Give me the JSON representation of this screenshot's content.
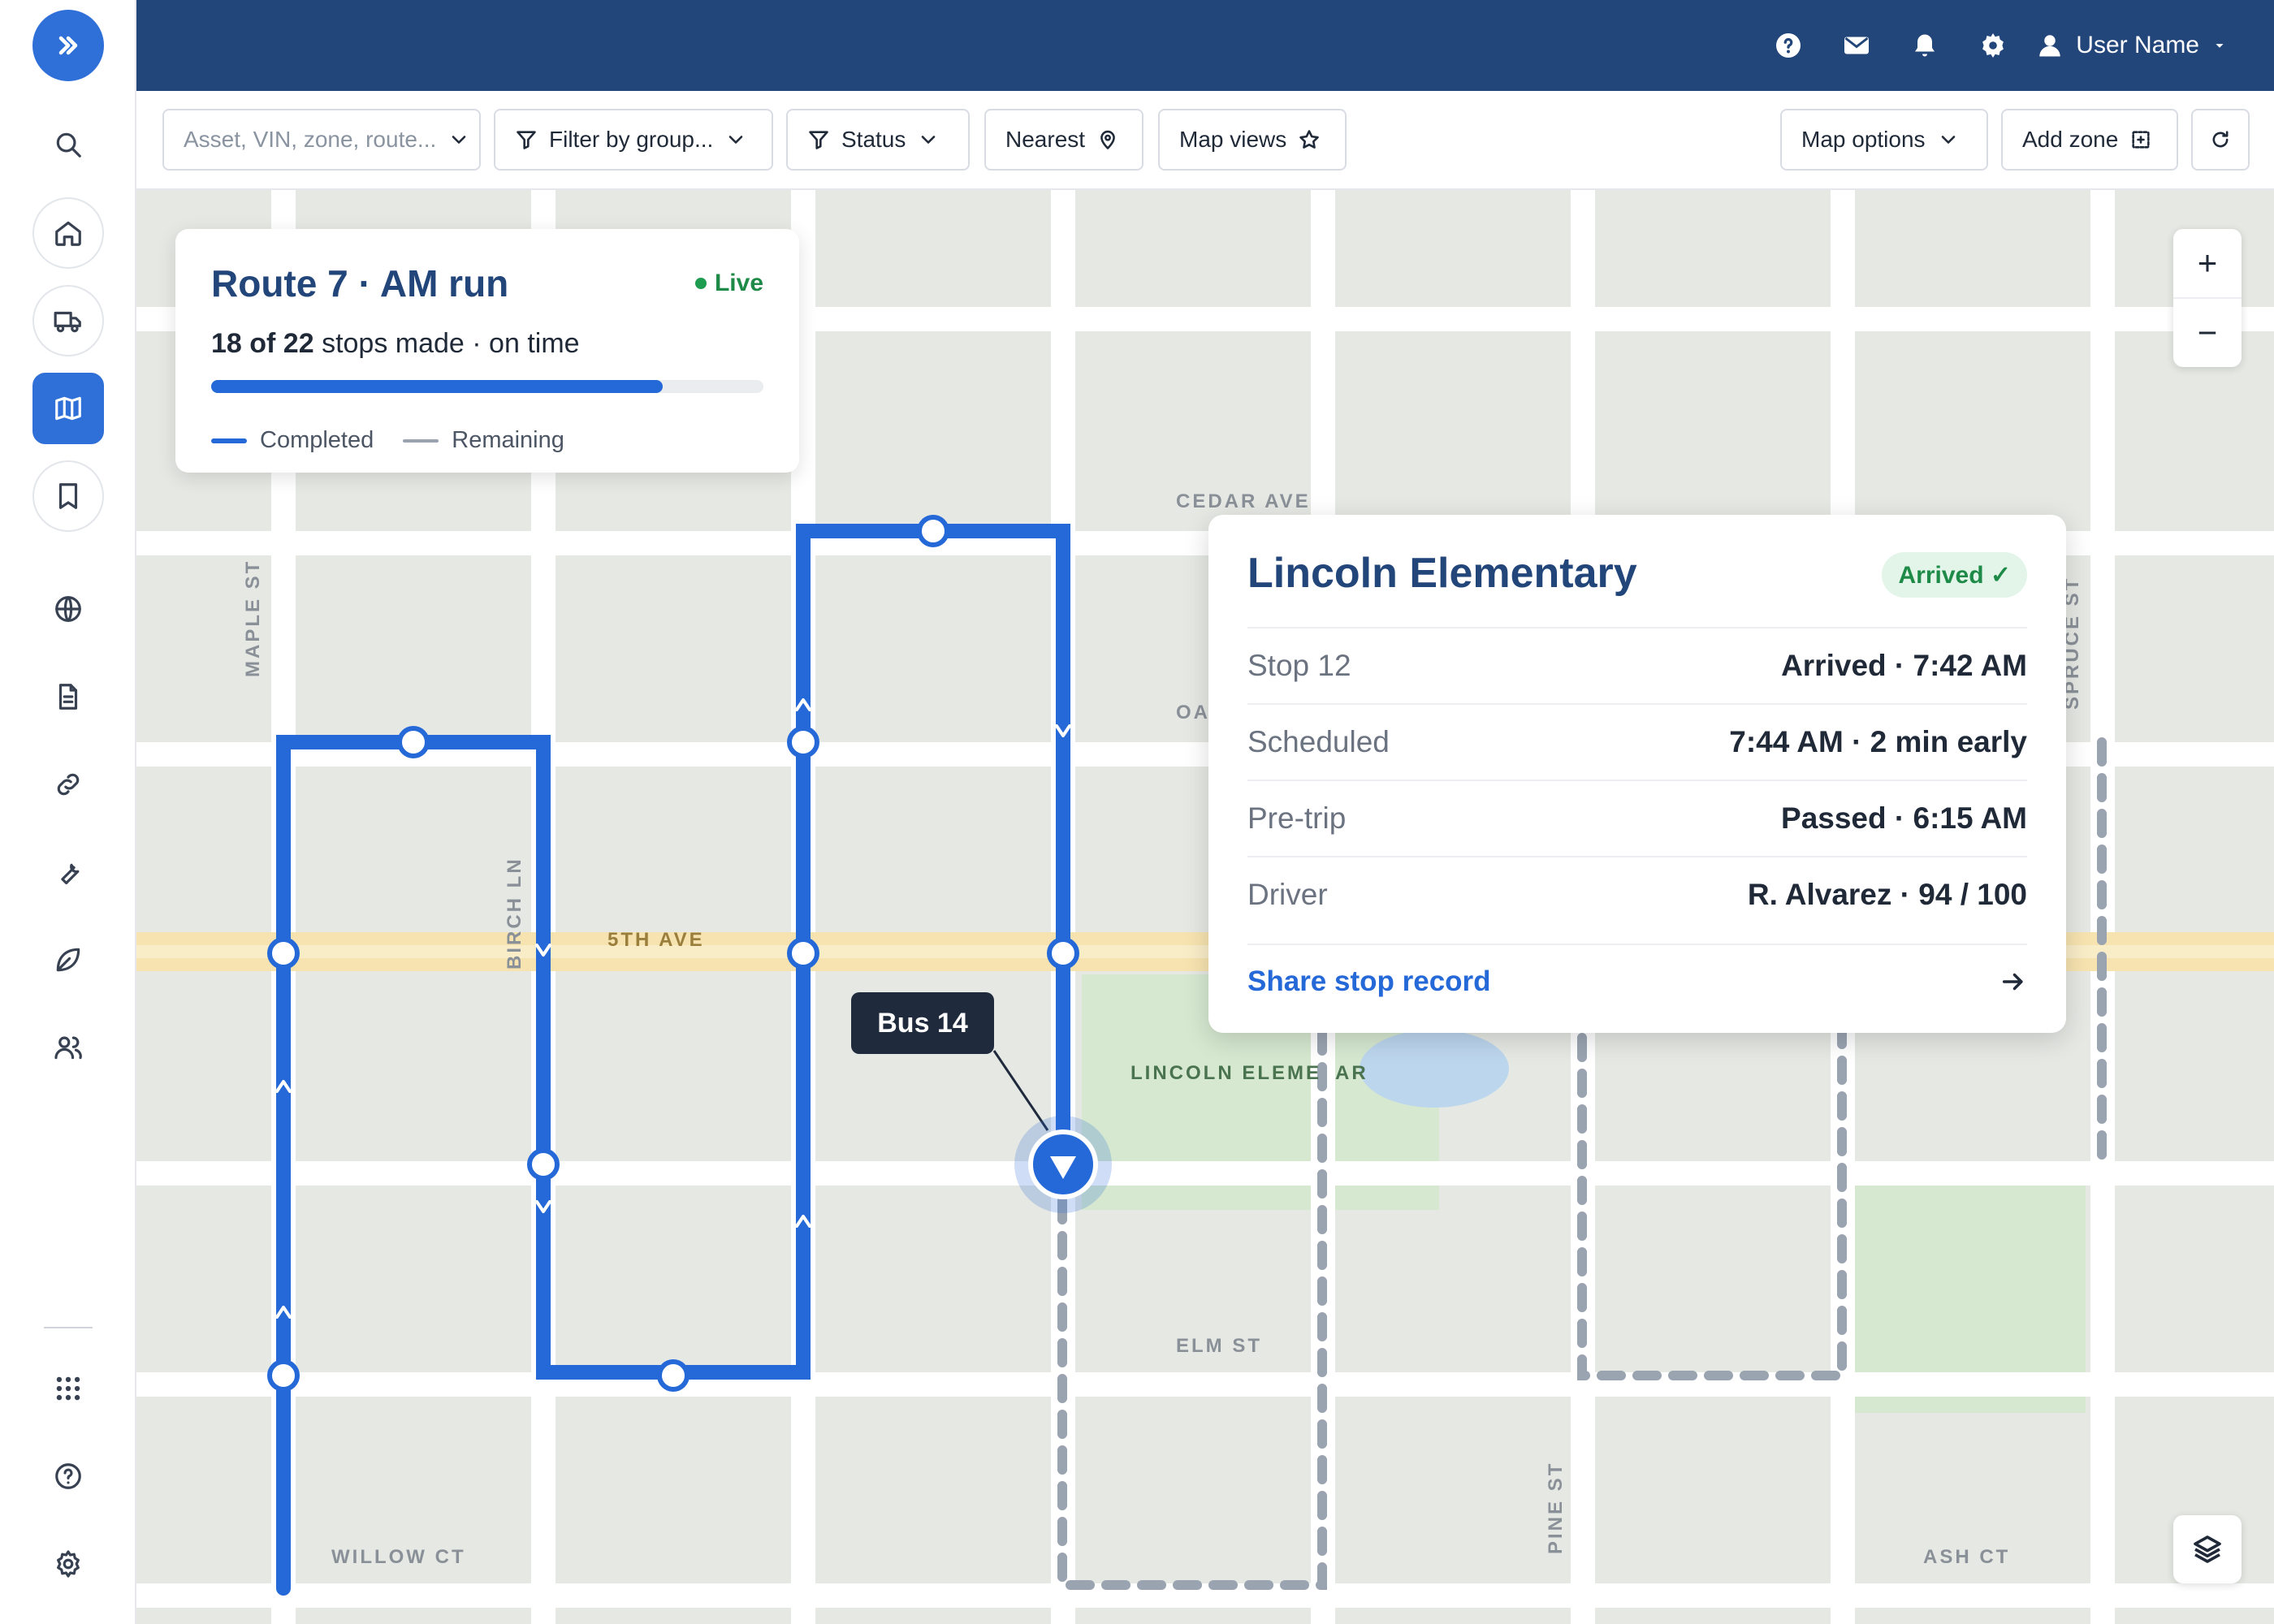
{
  "nav": {
    "icons": [
      "chevrons-right-icon",
      "search-icon",
      "home-icon",
      "truck-icon",
      "map-icon",
      "bookmark-icon",
      "globe-icon",
      "document-icon",
      "link-icon",
      "wrench-icon",
      "leaf-icon",
      "users-icon",
      "apps-grid-icon",
      "help-circle-icon",
      "settings-icon"
    ],
    "active": "map"
  },
  "topbar": {
    "icons": [
      "help-icon",
      "mail-icon",
      "bell-icon",
      "gear-icon",
      "user-icon"
    ],
    "user_name": "User Name"
  },
  "toolbar": {
    "search_placeholder": "Asset, VIN, zone, route...",
    "filter_group_label": "Filter by group...",
    "status_label": "Status",
    "nearest_label": "Nearest",
    "map_views_label": "Map views",
    "map_options_label": "Map options",
    "add_zone_label": "Add zone"
  },
  "map": {
    "streets": {
      "cedar": "CEDAR AVE",
      "oak": "OA",
      "fifth": "5TH AVE",
      "elm": "ELM ST",
      "willow": "WILLOW CT",
      "ash": "ASH CT",
      "maple": "MAPLE ST",
      "birch": "BIRCH LN",
      "pine": "PINE ST",
      "spruce": "SPRUCE ST",
      "park_left": "LINCOLN ELEME",
      "park_right": "AR"
    },
    "route_color": "#2569d8",
    "remaining_color": "#9aa4b1"
  },
  "route_card": {
    "title": "Route 7 · AM run",
    "status": "Live",
    "stops_made": "18 of 22",
    "stops_suffix": "stops made · on time",
    "progress": 0.818,
    "legend_completed": "Completed",
    "legend_remaining": "Remaining"
  },
  "stop_popup": {
    "title": "Lincoln Elementary",
    "badge": "Arrived ✓",
    "rows": [
      {
        "label": "Stop 12",
        "value": "Arrived · 7:42 AM"
      },
      {
        "label": "Scheduled",
        "value": "7:44 AM · 2 min early"
      },
      {
        "label": "Pre-trip",
        "value": "Passed · 6:15 AM"
      },
      {
        "label": "Driver",
        "value": "R. Alvarez · 94 / 100"
      }
    ],
    "share_label": "Share stop record"
  },
  "bus": {
    "label": "Bus 14"
  },
  "zoom": {
    "in": "+",
    "out": "−"
  }
}
